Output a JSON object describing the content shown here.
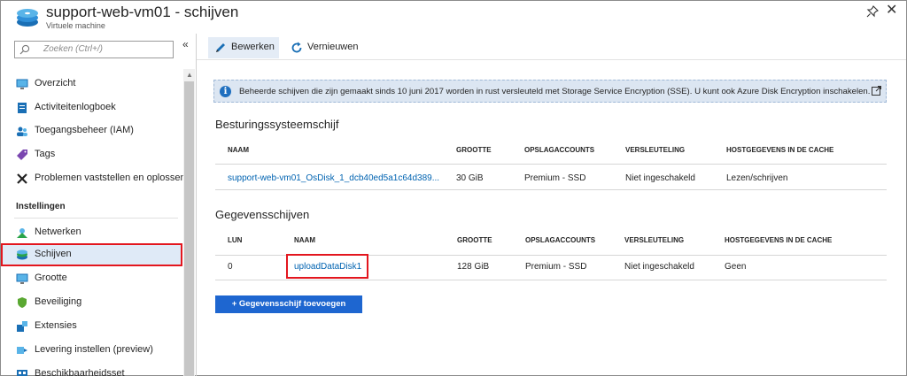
{
  "header": {
    "title": "support-web-vm01 - schijven",
    "subtitle": "Virtuele machine",
    "icon": "disk-stack-icon",
    "pin_icon": "pin-icon",
    "close_icon": "close-icon"
  },
  "sidebar": {
    "search_placeholder": "Zoeken (Ctrl+/)",
    "collapse": "«",
    "items": [
      {
        "label": "Overzicht",
        "icon": "monitor-icon"
      },
      {
        "label": "Activiteitenlogboek",
        "icon": "log-icon"
      },
      {
        "label": "Toegangsbeheer (IAM)",
        "icon": "people-icon"
      },
      {
        "label": "Tags",
        "icon": "tag-icon"
      },
      {
        "label": "Problemen vaststellen en oplossen",
        "icon": "tools-icon"
      }
    ],
    "section_title": "Instellingen",
    "settings_items": [
      {
        "label": "Netwerken",
        "icon": "network-icon"
      },
      {
        "label": "Schijven",
        "icon": "disk-icon",
        "selected": true
      },
      {
        "label": "Grootte",
        "icon": "monitor-size-icon"
      },
      {
        "label": "Beveiliging",
        "icon": "shield-icon"
      },
      {
        "label": "Extensies",
        "icon": "extensions-icon"
      },
      {
        "label": "Levering instellen (preview)",
        "icon": "delivery-icon"
      },
      {
        "label": "Beschikbaarheidsset",
        "icon": "availability-icon"
      }
    ]
  },
  "toolbar": {
    "edit_label": "Bewerken",
    "refresh_label": "Vernieuwen"
  },
  "info": {
    "text": "Beheerde schijven die zijn gemaakt sinds 10 juni 2017 worden in rust versleuteld met Storage Service Encryption (SSE). U kunt ook Azure Disk Encryption inschakelen."
  },
  "os_disk": {
    "title": "Besturingssysteemschijf",
    "headers": [
      "NAAM",
      "GROOTTE",
      "OPSLAGACCOUNTS",
      "VERSLEUTELING",
      "HOSTGEGEVENS IN DE CACHE"
    ],
    "row": [
      "support-web-vm01_OsDisk_1_dcb40ed5a1c64d389...",
      "30 GiB",
      "Premium - SSD",
      "Niet ingeschakeld",
      "Lezen/schrijven"
    ]
  },
  "data_disks": {
    "title": "Gegevensschijven",
    "headers": [
      "LUN",
      "NAAM",
      "GROOTTE",
      "OPSLAGACCOUNTS",
      "VERSLEUTELING",
      "HOSTGEGEVENS IN DE CACHE"
    ],
    "row": [
      "0",
      "uploadDataDisk1",
      "128 GiB",
      "Premium - SSD",
      "Niet ingeschakeld",
      "Geen"
    ]
  },
  "add_button": "+ Gegevensschijf toevoegen",
  "colors": {
    "accent": "#1e66d0",
    "link": "#0063b1",
    "highlight": "#e3161e",
    "selected_bg": "#dfeaf7"
  }
}
